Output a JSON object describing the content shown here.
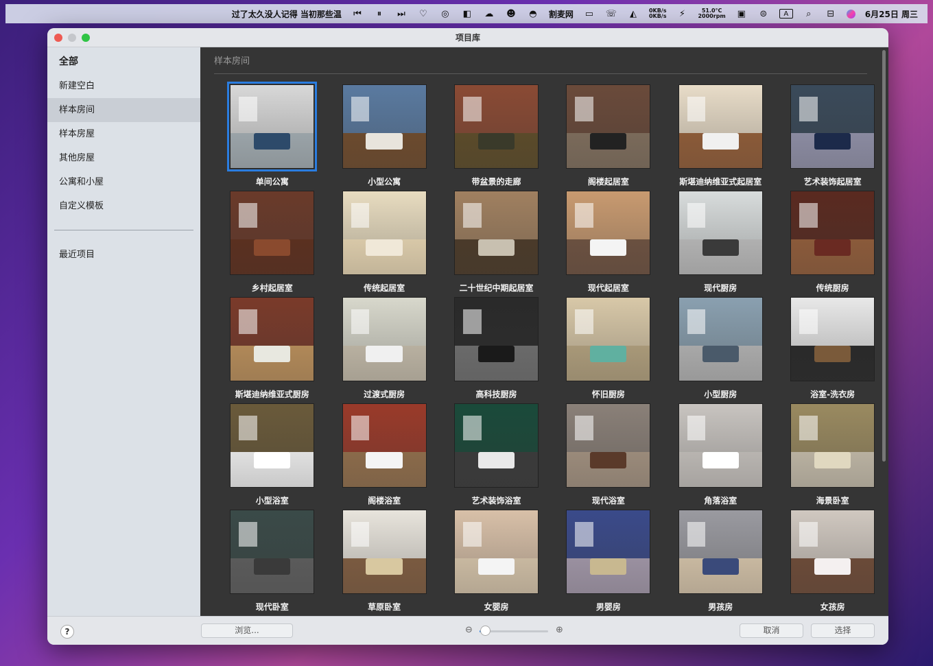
{
  "menubar": {
    "now_playing": "过了太久没人记得 当初那些温",
    "net_up": "0KB/s",
    "net_down": "0KB/s",
    "site": "割麦网",
    "temp": "51.0°C",
    "fan": "2000rpm",
    "input_method": "A",
    "datetime": "6月25日 周三"
  },
  "window": {
    "title": "项目库"
  },
  "sidebar": {
    "items": [
      {
        "label": "全部"
      },
      {
        "label": "新建空白"
      },
      {
        "label": "样本房间"
      },
      {
        "label": "样本房屋"
      },
      {
        "label": "其他房屋"
      },
      {
        "label": "公寓和小屋"
      },
      {
        "label": "自定义模板"
      }
    ],
    "recent": "最近项目",
    "selected_index": 2
  },
  "main": {
    "section_title": "样本房间",
    "rooms": [
      {
        "label": "单间公寓",
        "wall": "#d8d8d8",
        "floor": "#9aa3a8",
        "furn": "#2d4a6a",
        "selected": true
      },
      {
        "label": "小型公寓",
        "wall": "#5a7aa0",
        "floor": "#6b4a2e",
        "furn": "#e8e4dc"
      },
      {
        "label": "带盆景的走廊",
        "wall": "#8a4a34",
        "floor": "#5a4a2a",
        "furn": "#3a3a2a"
      },
      {
        "label": "阁楼起居室",
        "wall": "#6a4a3a",
        "floor": "#7a6a5a",
        "furn": "#222222"
      },
      {
        "label": "斯堪迪纳维亚式起居室",
        "wall": "#e8dcc8",
        "floor": "#8a5a38",
        "furn": "#f0f0f0"
      },
      {
        "label": "艺术装饰起居室",
        "wall": "#3a4a5a",
        "floor": "#8a8aa0",
        "furn": "#1c2a4a"
      },
      {
        "label": "乡村起居室",
        "wall": "#6a3a2a",
        "floor": "#5a3020",
        "furn": "#8a4a2e"
      },
      {
        "label": "传统起居室",
        "wall": "#e8dcc0",
        "floor": "#d8c8a8",
        "furn": "#f0e8d8"
      },
      {
        "label": "二十世纪中期起居室",
        "wall": "#a08060",
        "floor": "#4a3a2a",
        "furn": "#c8c0b0"
      },
      {
        "label": "现代起居室",
        "wall": "#c89a70",
        "floor": "#6a5040",
        "furn": "#f4f4f4"
      },
      {
        "label": "现代厨房",
        "wall": "#d8dcdc",
        "floor": "#b0b0b0",
        "furn": "#3a3a3a"
      },
      {
        "label": "传统厨房",
        "wall": "#5a2a20",
        "floor": "#8a5a3a",
        "furn": "#6a2a22"
      },
      {
        "label": "斯堪迪纳维亚式厨房",
        "wall": "#7a3a2a",
        "floor": "#b08858",
        "furn": "#e8e8e0"
      },
      {
        "label": "过渡式厨房",
        "wall": "#d8d8cc",
        "floor": "#b8b0a0",
        "furn": "#f0f0f0"
      },
      {
        "label": "高科技厨房",
        "wall": "#2a2a2a",
        "floor": "#6a6a6a",
        "furn": "#1a1a1a"
      },
      {
        "label": "怀旧厨房",
        "wall": "#d8c8a8",
        "floor": "#a89878",
        "furn": "#60b0a0"
      },
      {
        "label": "小型厨房",
        "wall": "#8aa0b0",
        "floor": "#a8a8a8",
        "furn": "#4a5a6a"
      },
      {
        "label": "浴室-洗衣房",
        "wall": "#e8e8e8",
        "floor": "#2a2a2a",
        "furn": "#7a5a3a"
      },
      {
        "label": "小型浴室",
        "wall": "#6a5a3a",
        "floor": "#e0e0e0",
        "furn": "#ffffff"
      },
      {
        "label": "阁楼浴室",
        "wall": "#9a3a2a",
        "floor": "#8a6a4a",
        "furn": "#f4f4f4"
      },
      {
        "label": "艺术装饰浴室",
        "wall": "#1a4a3a",
        "floor": "#3a3a3a",
        "furn": "#e8e8e8"
      },
      {
        "label": "现代浴室",
        "wall": "#8a8078",
        "floor": "#9a8a7a",
        "furn": "#5a3a2a"
      },
      {
        "label": "角落浴室",
        "wall": "#c8c4c0",
        "floor": "#b8b4b0",
        "furn": "#ffffff"
      },
      {
        "label": "海景卧室",
        "wall": "#9a8a60",
        "floor": "#b8b0a0",
        "furn": "#e0d8c0"
      },
      {
        "label": "现代卧室",
        "wall": "#3a4a48",
        "floor": "#5a5a5a",
        "furn": "#3a3a3a"
      },
      {
        "label": "草原卧室",
        "wall": "#e8e4dc",
        "floor": "#7a5a40",
        "furn": "#d8c8a0"
      },
      {
        "label": "女婴房",
        "wall": "#d8c0a8",
        "floor": "#c8b8a0",
        "furn": "#f4f4f4"
      },
      {
        "label": "男婴房",
        "wall": "#3a4a8a",
        "floor": "#9a90a0",
        "furn": "#c8b890"
      },
      {
        "label": "男孩房",
        "wall": "#9a9aa0",
        "floor": "#c8b8a0",
        "furn": "#3a4a7a"
      },
      {
        "label": "女孩房",
        "wall": "#d0c8c0",
        "floor": "#6a4a38",
        "furn": "#f4f0f0"
      }
    ]
  },
  "footer": {
    "help": "?",
    "browse": "浏览...",
    "cancel": "取消",
    "select": "选择",
    "zoom_level": 0.08
  },
  "colors": {
    "accent": "#2a7de0",
    "content_bg": "#353535",
    "sidebar_bg": "#dce1e7"
  }
}
